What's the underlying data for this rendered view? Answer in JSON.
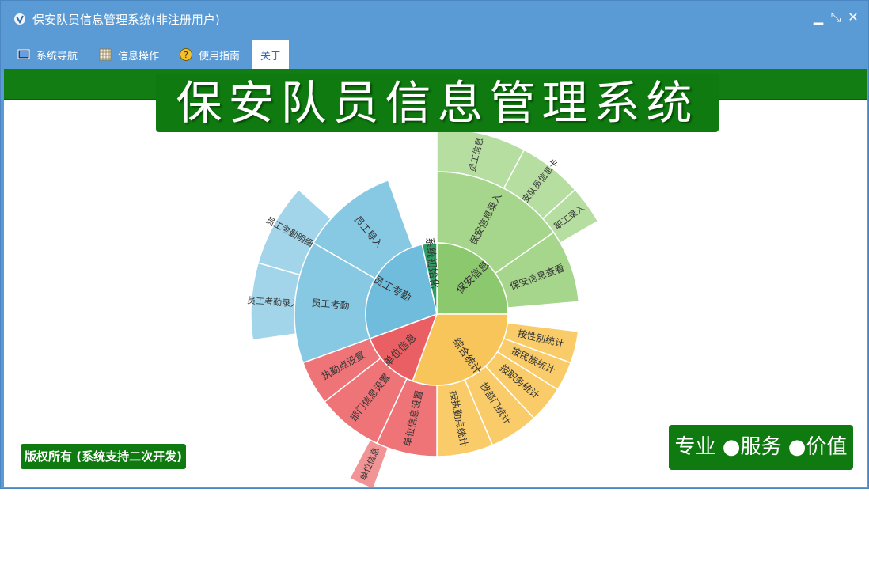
{
  "window": {
    "title": "保安队员信息管理系统(非注册用户)",
    "buttons": {
      "minimize": "▁",
      "restore": "⤡",
      "close": "✕"
    }
  },
  "menu": [
    {
      "label": "系统导航",
      "icon": "monitor-icon"
    },
    {
      "label": "信息操作",
      "icon": "grid-icon"
    },
    {
      "label": "使用指南",
      "icon": "help-icon"
    },
    {
      "label": "关于",
      "icon": ""
    }
  ],
  "banner": {
    "title": "保安队员信息管理系统"
  },
  "footer": {
    "copyright": "版权所有 (系统支持二次开发)",
    "slogan": "专业 ●服务 ●价值"
  },
  "colors": {
    "window_blue": "#5b9bd5",
    "brand_green": "#0f7a0f",
    "baoan": "#8cc96e",
    "tongji": "#f8c55a",
    "danwei": "#ea5f63",
    "yuangong": "#70bcdc",
    "xitong": "#2d9d63"
  },
  "sunburst": {
    "inner": [
      {
        "label": "保安信息",
        "group": "baoan"
      },
      {
        "label": "综合统计",
        "group": "tongji"
      },
      {
        "label": "单位信息",
        "group": "danwei"
      },
      {
        "label": "员工考勤",
        "group": "yuangong"
      },
      {
        "label": "系统初始化",
        "group": "xitong"
      }
    ],
    "middle": [
      {
        "label": "保安信息录入",
        "group": "baoan"
      },
      {
        "label": "保安信息查看",
        "group": "baoan"
      },
      {
        "label": "按性别统计",
        "group": "tongji"
      },
      {
        "label": "按民族统计",
        "group": "tongji"
      },
      {
        "label": "按职务统计",
        "group": "tongji"
      },
      {
        "label": "按部门统计",
        "group": "tongji"
      },
      {
        "label": "按执勤点统计",
        "group": "tongji"
      },
      {
        "label": "单位信息设置",
        "group": "danwei"
      },
      {
        "label": "部门信息设置",
        "group": "danwei"
      },
      {
        "label": "执勤点设置",
        "group": "danwei"
      },
      {
        "label": "员工考勤",
        "group": "yuangong"
      },
      {
        "label": "员工导入",
        "group": "yuangong"
      }
    ],
    "outer": [
      {
        "label": "员工信息",
        "group": "baoan"
      },
      {
        "label": "保安队员信息卡",
        "group": "baoan"
      },
      {
        "label": "职工录入",
        "group": "baoan"
      },
      {
        "label": "单位信息",
        "group": "danwei"
      },
      {
        "label": "员工考勤录入",
        "group": "yuangong"
      },
      {
        "label": "员工考勤明细表",
        "group": "yuangong"
      }
    ]
  }
}
